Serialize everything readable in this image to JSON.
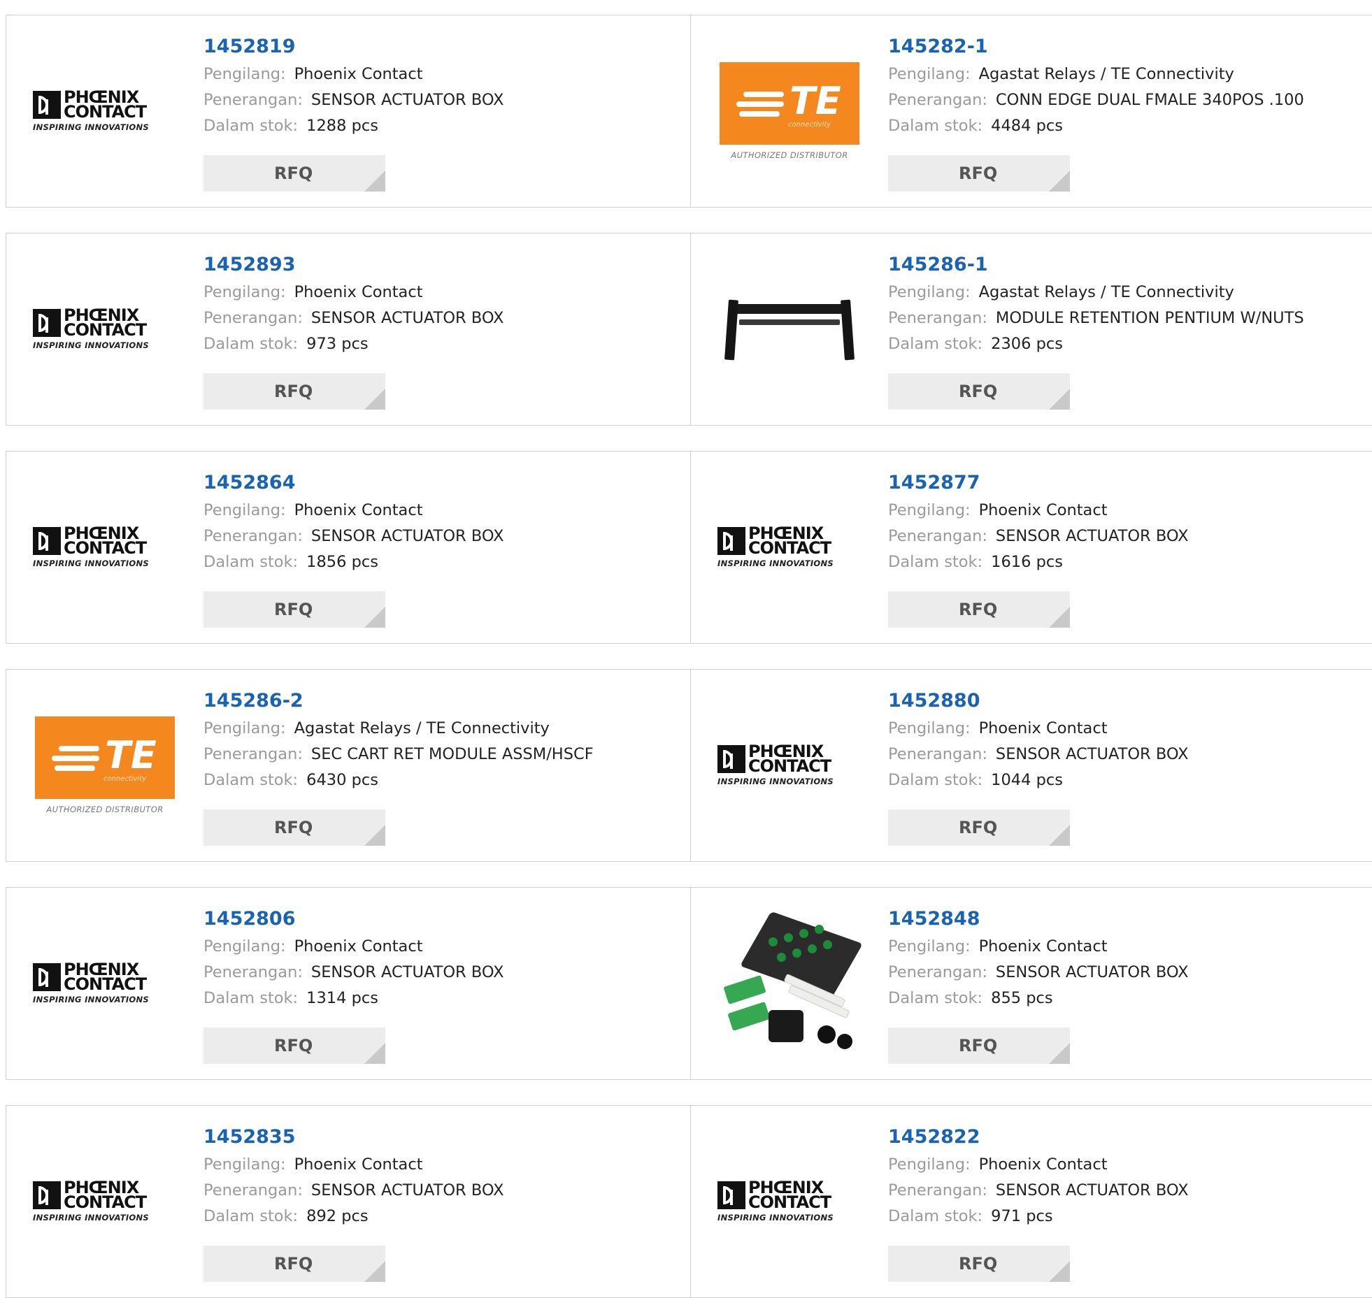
{
  "labels": {
    "manufacturer": "Pengilang:",
    "description": "Penerangan:",
    "stock": "Dalam stok:",
    "rfq": "RFQ"
  },
  "logos": {
    "phoenix_line1": "PHŒNIX",
    "phoenix_line2": "CONTACT",
    "phoenix_tagline": "INSPIRING INNOVATIONS",
    "te_text": "TE",
    "te_sub": "connectivity",
    "te_authorized": "AUTHORIZED DISTRIBUTOR"
  },
  "colors": {
    "part_link": "#1a63b0",
    "te_orange": "#f5871f",
    "rfq_bg": "#ececec"
  },
  "products": [
    {
      "part": "1452819",
      "manufacturer": "Phoenix Contact",
      "description": "SENSOR ACTUATOR BOX",
      "stock": "1288 pcs",
      "image": "phoenix-logo"
    },
    {
      "part": "145282-1",
      "manufacturer": "Agastat Relays / TE Connectivity",
      "description": "CONN EDGE DUAL FMALE 340POS .100",
      "stock": "4484 pcs",
      "image": "te-logo"
    },
    {
      "part": "1452893",
      "manufacturer": "Phoenix Contact",
      "description": "SENSOR ACTUATOR BOX",
      "stock": "973 pcs",
      "image": "phoenix-logo"
    },
    {
      "part": "145286-1",
      "manufacturer": "Agastat Relays / TE Connectivity",
      "description": "MODULE RETENTION PENTIUM W/NUTS",
      "stock": "2306 pcs",
      "image": "retention-module-photo"
    },
    {
      "part": "1452864",
      "manufacturer": "Phoenix Contact",
      "description": "SENSOR ACTUATOR BOX",
      "stock": "1856 pcs",
      "image": "phoenix-logo"
    },
    {
      "part": "1452877",
      "manufacturer": "Phoenix Contact",
      "description": "SENSOR ACTUATOR BOX",
      "stock": "1616 pcs",
      "image": "phoenix-logo"
    },
    {
      "part": "145286-2",
      "manufacturer": "Agastat Relays / TE Connectivity",
      "description": "SEC CART RET MODULE ASSM/HSCF",
      "stock": "6430 pcs",
      "image": "te-logo"
    },
    {
      "part": "1452880",
      "manufacturer": "Phoenix Contact",
      "description": "SENSOR ACTUATOR BOX",
      "stock": "1044 pcs",
      "image": "phoenix-logo"
    },
    {
      "part": "1452806",
      "manufacturer": "Phoenix Contact",
      "description": "SENSOR ACTUATOR BOX",
      "stock": "1314 pcs",
      "image": "phoenix-logo"
    },
    {
      "part": "1452848",
      "manufacturer": "Phoenix Contact",
      "description": "SENSOR ACTUATOR BOX",
      "stock": "855 pcs",
      "image": "sensor-box-photo"
    },
    {
      "part": "1452835",
      "manufacturer": "Phoenix Contact",
      "description": "SENSOR ACTUATOR BOX",
      "stock": "892 pcs",
      "image": "phoenix-logo"
    },
    {
      "part": "1452822",
      "manufacturer": "Phoenix Contact",
      "description": "SENSOR ACTUATOR BOX",
      "stock": "971 pcs",
      "image": "phoenix-logo"
    }
  ]
}
